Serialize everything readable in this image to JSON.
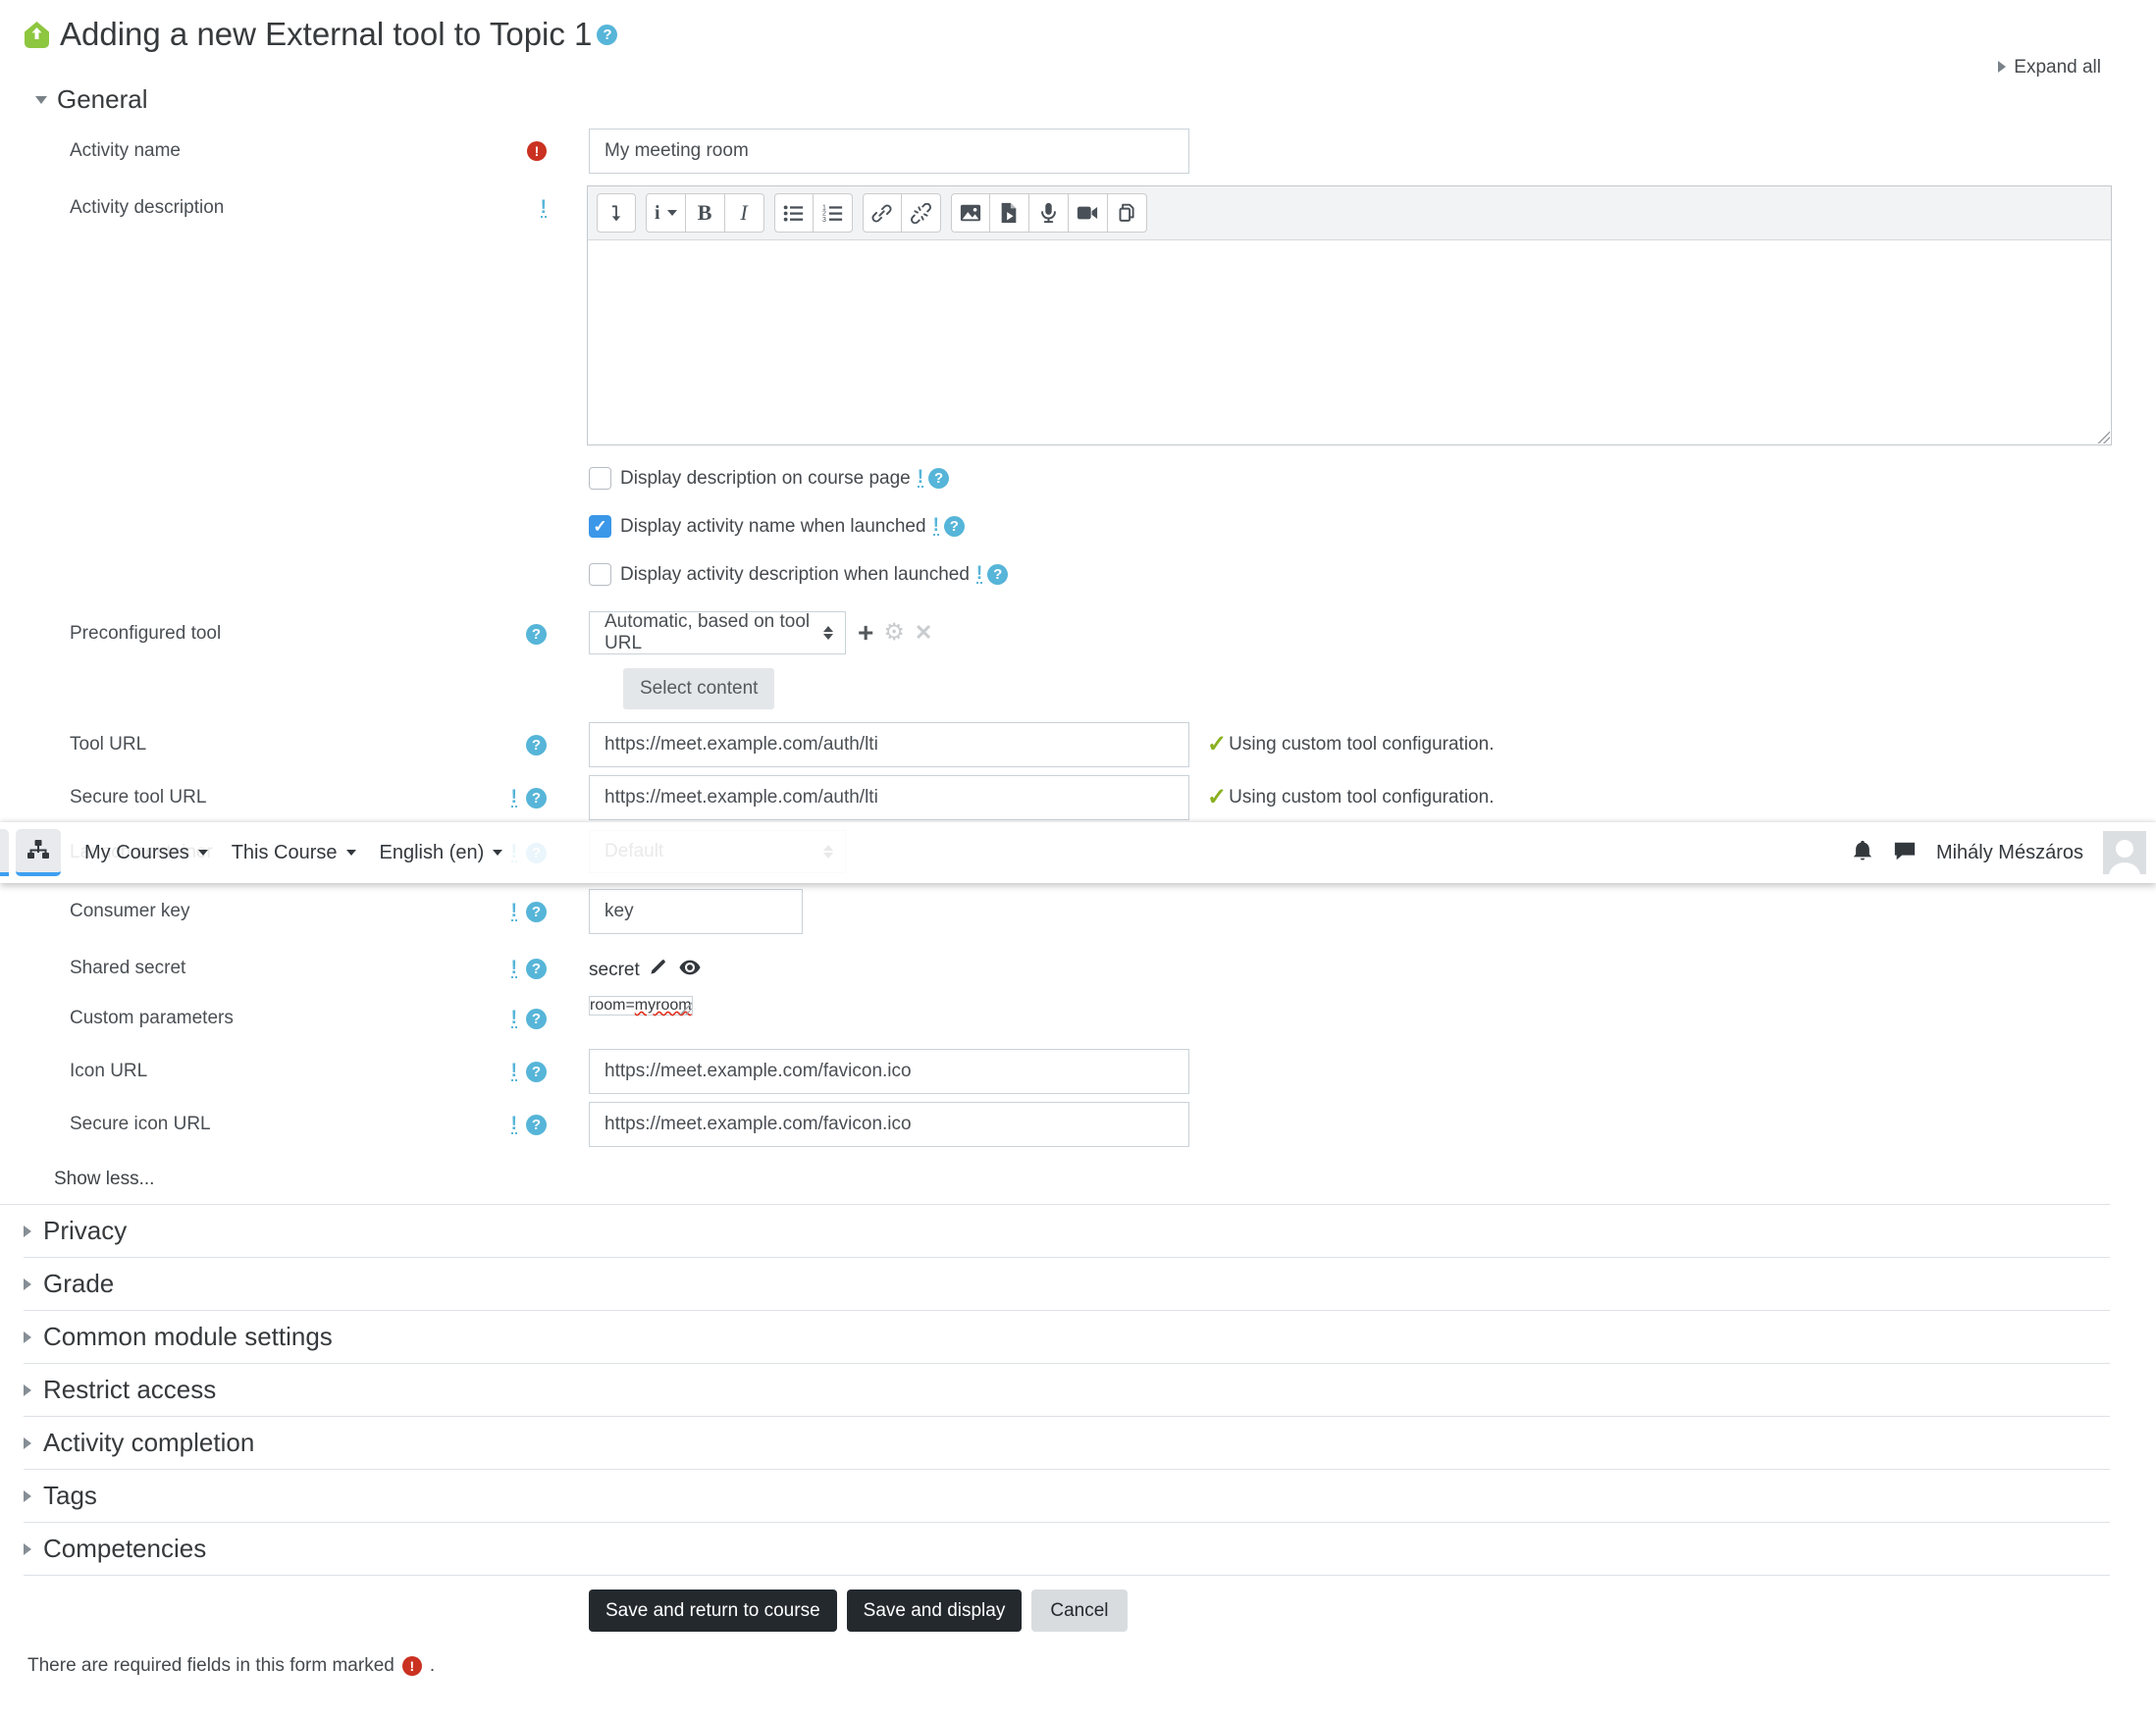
{
  "header": {
    "title": "Adding a new External tool to Topic 1",
    "expand_all": "Expand all"
  },
  "general": {
    "heading": "General"
  },
  "rows": {
    "activity_name": {
      "label": "Activity name",
      "value": "My meeting room"
    },
    "activity_description": {
      "label": "Activity description"
    },
    "preconfigured_tool": {
      "label": "Preconfigured tool",
      "value": "Automatic, based on tool URL"
    },
    "select_content": {
      "label": "Select content"
    },
    "tool_url": {
      "label": "Tool URL",
      "value": "https://meet.example.com/auth/lti",
      "status": "Using custom tool configuration."
    },
    "secure_tool_url": {
      "label": "Secure tool URL",
      "value": "https://meet.example.com/auth/lti",
      "status": "Using custom tool configuration."
    },
    "launch_container": {
      "label": "Launch container",
      "value": "Default"
    },
    "consumer_key": {
      "label": "Consumer key",
      "value": "key"
    },
    "shared_secret": {
      "label": "Shared secret",
      "value": "secret"
    },
    "custom_parameters": {
      "label": "Custom parameters",
      "value_head": "room=",
      "value_tail": "myroom"
    },
    "icon_url": {
      "label": "Icon URL",
      "value": "https://meet.example.com/favicon.ico"
    },
    "secure_icon_url": {
      "label": "Secure icon URL",
      "value": "https://meet.example.com/favicon.ico"
    }
  },
  "checkboxes": [
    {
      "label": "Display description on course page",
      "checked": false
    },
    {
      "label": "Display activity name when launched",
      "checked": true
    },
    {
      "label": "Display activity description when launched",
      "checked": false
    }
  ],
  "editor": {
    "styles_letter": "i",
    "bold_label": "B",
    "italic_label": "I",
    "toolbar_icons": [
      "collapse-toolbar-icon",
      "paragraph-styles-icon",
      "bold-icon",
      "italic-icon",
      "unordered-list-icon",
      "ordered-list-icon",
      "link-icon",
      "unlink-icon",
      "insert-image-icon",
      "insert-media-icon",
      "record-audio-icon",
      "record-video-icon",
      "manage-files-icon"
    ]
  },
  "navbar": {
    "items": [
      {
        "label": "My Courses"
      },
      {
        "label": "This Course"
      },
      {
        "label": "English (en)"
      }
    ],
    "user_name": "Mihály Mészáros",
    "icons": [
      "sitemap-icon",
      "bell-icon",
      "chat-icon",
      "avatar"
    ]
  },
  "footer": {
    "show_less": "Show less...",
    "required_note": "There are required fields in this form marked",
    "required_note_suffix": "."
  },
  "collapsed_sections": [
    {
      "label": "Privacy"
    },
    {
      "label": "Grade"
    },
    {
      "label": "Common module settings"
    },
    {
      "label": "Restrict access"
    },
    {
      "label": "Activity completion"
    },
    {
      "label": "Tags"
    },
    {
      "label": "Competencies"
    }
  ],
  "buttons": {
    "save_return": "Save and return to course",
    "save_display": "Save and display",
    "cancel": "Cancel"
  },
  "colors": {
    "accent_blue": "#3b97e8",
    "help_blue": "#56b5d8",
    "required_red": "#ca3120",
    "success_green": "#8ab021",
    "badge_green": "#8dc63f",
    "button_dark": "#24292e",
    "tab_underline": "#3d9ff0"
  }
}
